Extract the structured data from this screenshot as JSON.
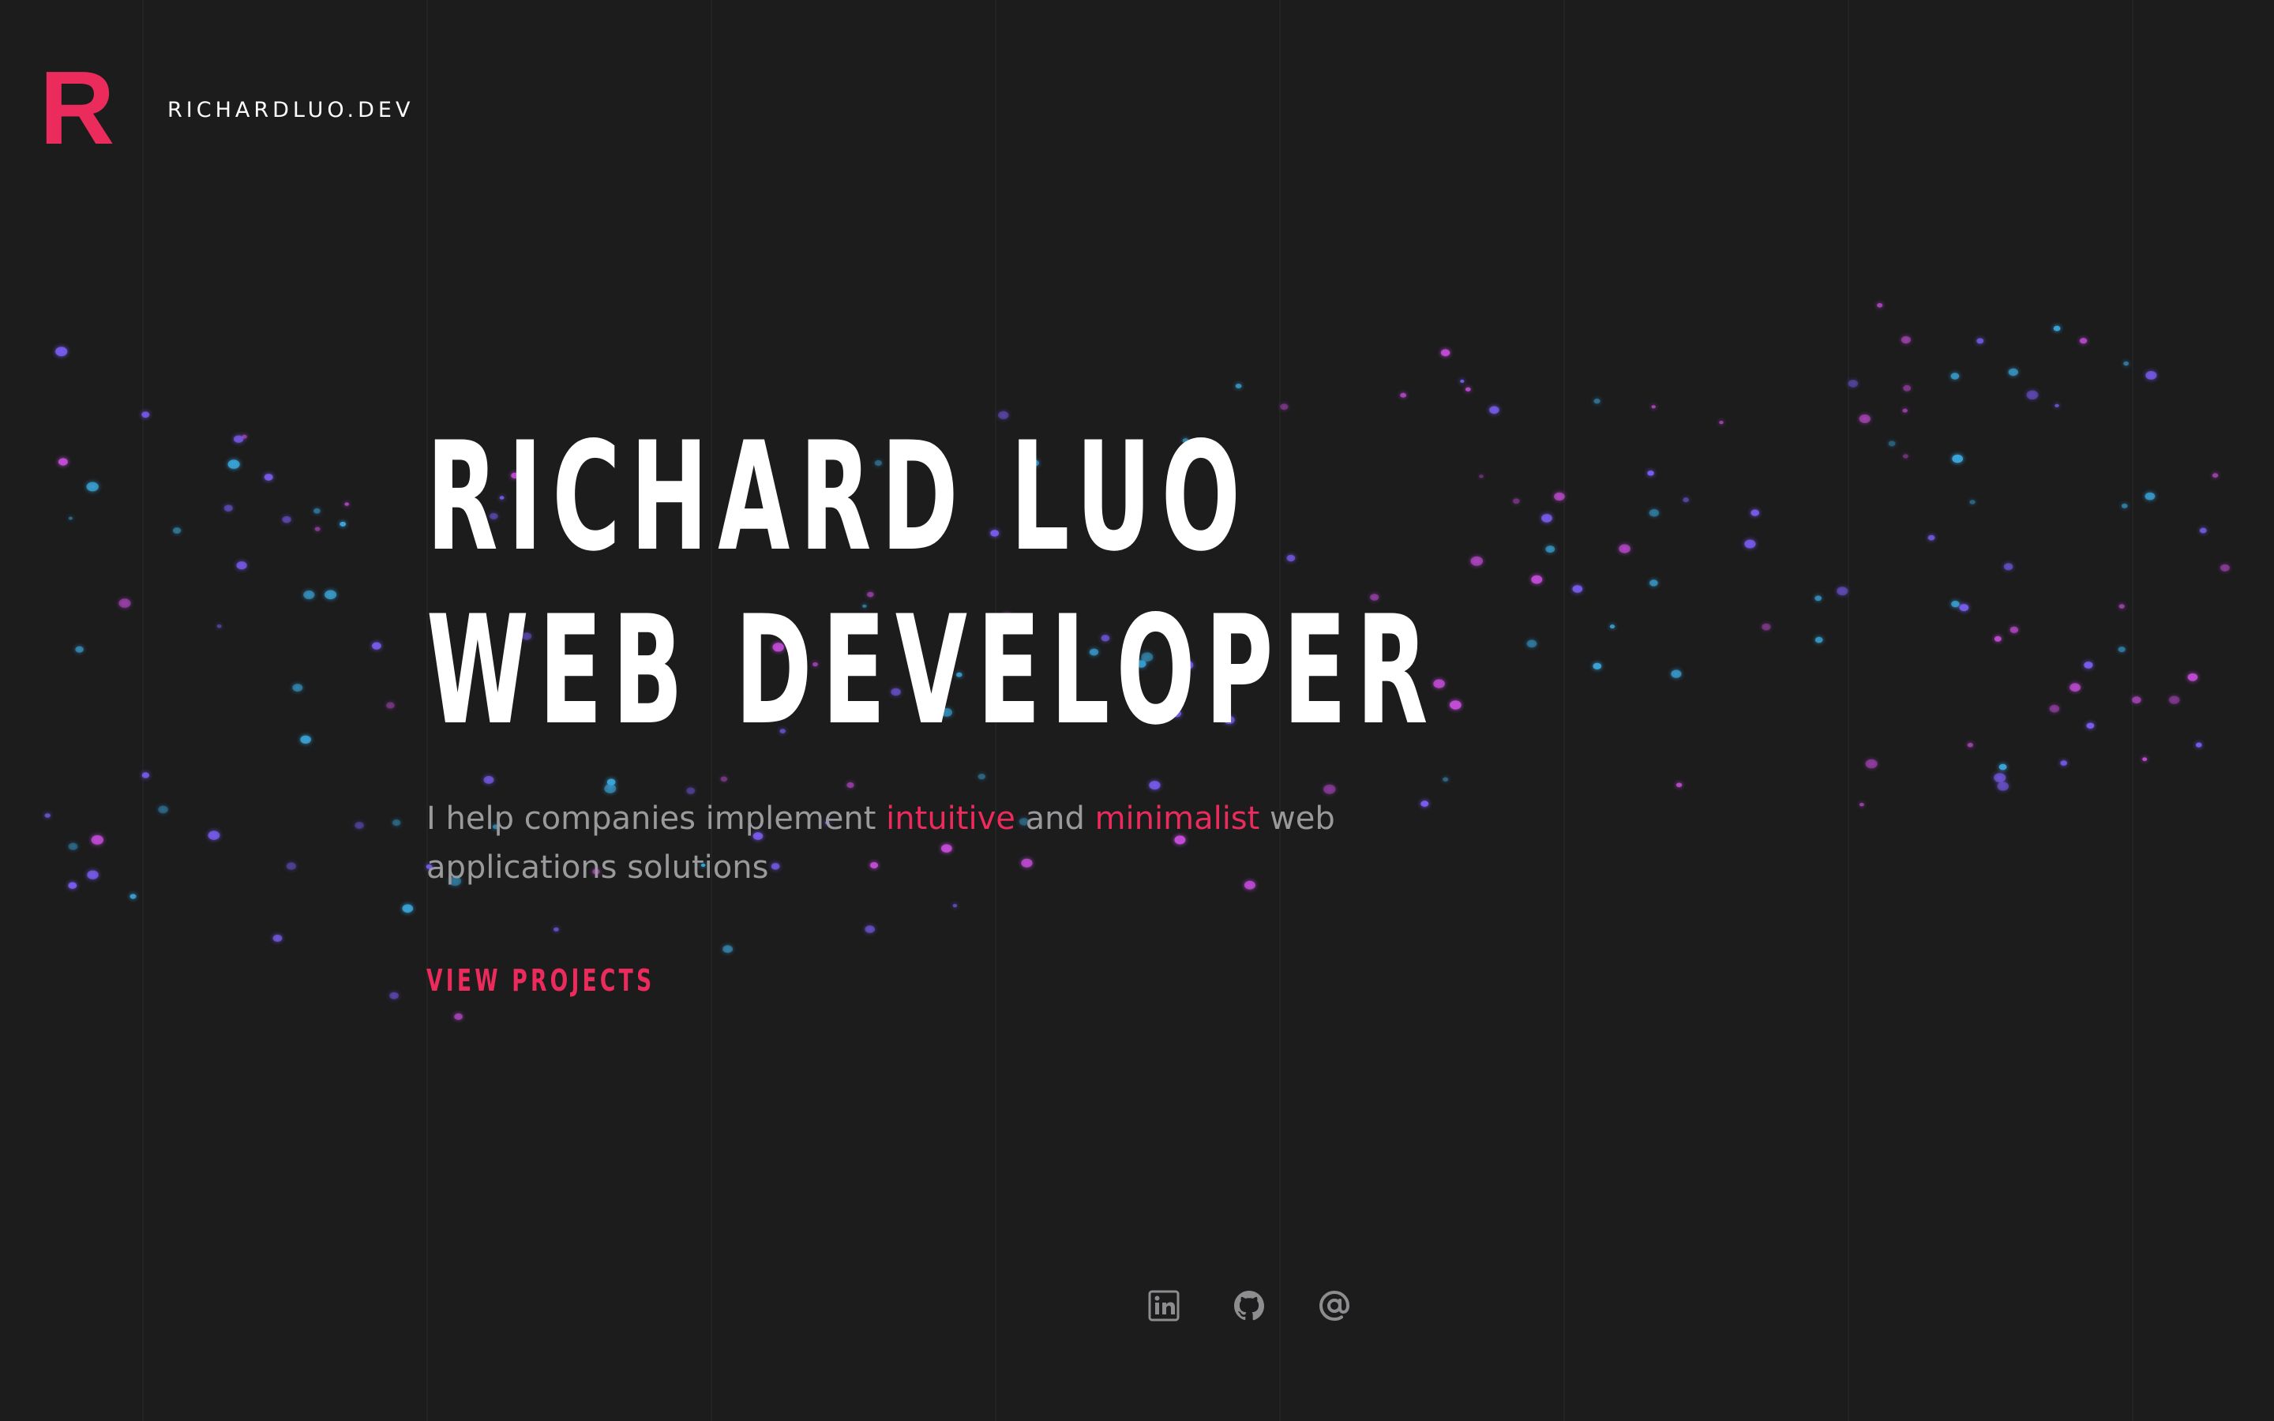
{
  "header": {
    "logo_letter": "R",
    "site_name": "RICHARDLUO.DEV"
  },
  "hero": {
    "title_line1": "RICHARD LUO",
    "title_line2": "WEB DEVELOPER",
    "tagline": {
      "part1": "I help companies implement ",
      "accent1": "intuitive",
      "part2": " and ",
      "accent2": "minimalist",
      "part3": " web applications solutions"
    },
    "cta_label": "VIEW PROJECTS"
  },
  "socials": [
    {
      "name": "linkedin",
      "icon": "linkedin-icon"
    },
    {
      "name": "github",
      "icon": "github-icon"
    },
    {
      "name": "email",
      "icon": "at-icon"
    }
  ],
  "colors": {
    "background": "#1c1c1d",
    "accent": "#ea2b5c",
    "text": "#ffffff",
    "muted": "#9a9a9c",
    "icon": "#8d8d8f",
    "particle_pink": "#c24bd6",
    "particle_blue": "#3aa4d8",
    "particle_violet": "#7a5cf0"
  }
}
